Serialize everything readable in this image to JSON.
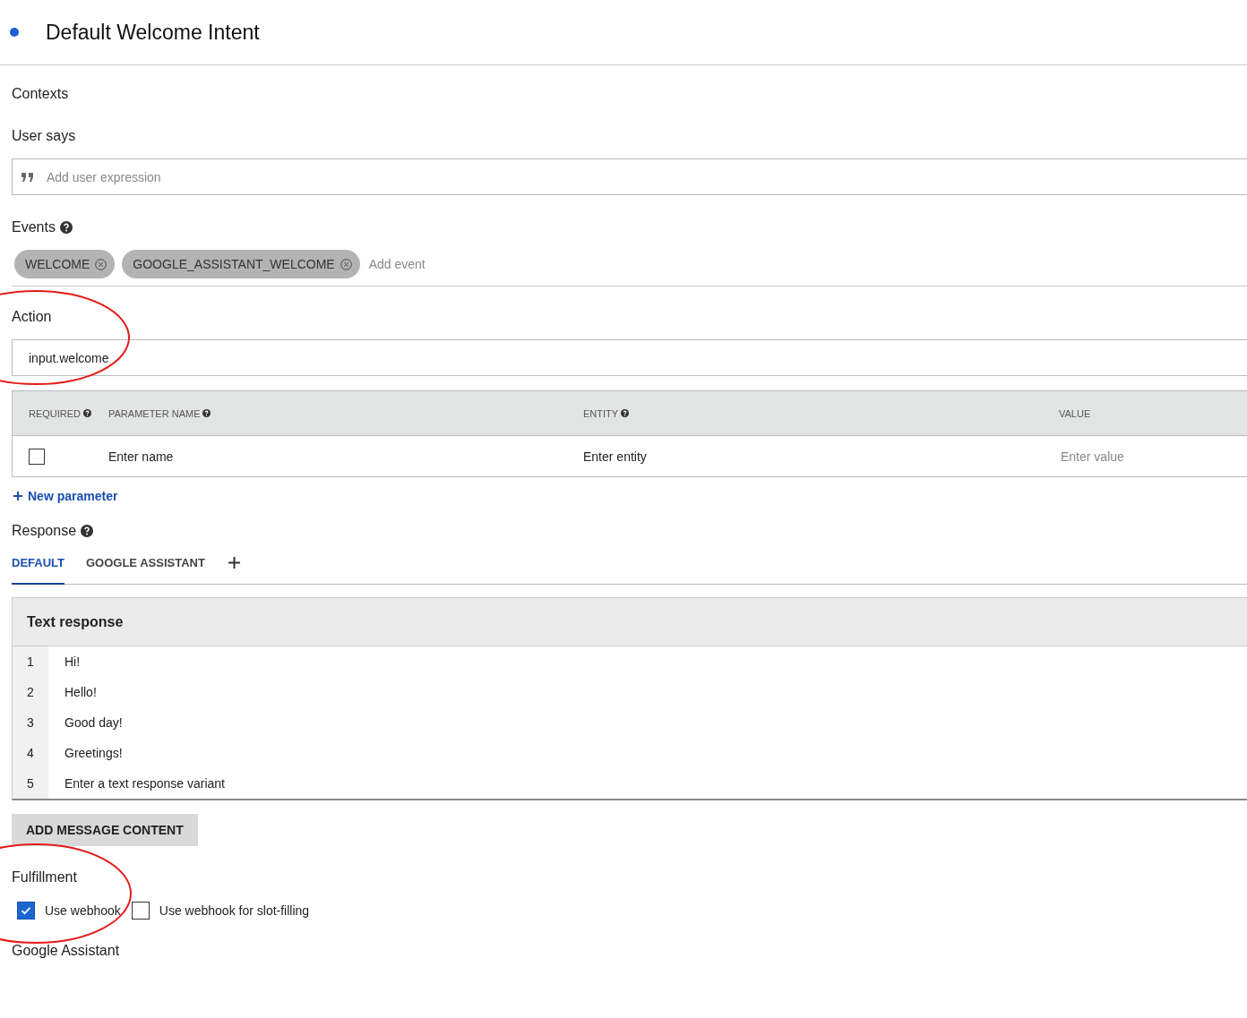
{
  "intent": {
    "title": "Default Welcome Intent"
  },
  "contexts": {
    "label": "Contexts"
  },
  "user_says": {
    "label": "User says",
    "placeholder": "Add user expression"
  },
  "events": {
    "label": "Events",
    "chips": [
      {
        "label": "WELCOME"
      },
      {
        "label": "GOOGLE_ASSISTANT_WELCOME"
      }
    ],
    "placeholder": "Add event"
  },
  "action": {
    "label": "Action",
    "value": "input.welcome",
    "circled": true
  },
  "parameters": {
    "columns": [
      {
        "label": "REQUIRED",
        "help": true
      },
      {
        "label": "PARAMETER NAME",
        "help": true
      },
      {
        "label": "ENTITY",
        "help": true
      },
      {
        "label": "VALUE",
        "help": false
      }
    ],
    "rows": [
      {
        "required": false,
        "name": "Enter name",
        "entity": "Enter entity",
        "value_placeholder": "Enter value"
      }
    ],
    "new_parameter": "New parameter"
  },
  "response": {
    "label": "Response",
    "tabs": [
      {
        "label": "DEFAULT",
        "selected": true
      },
      {
        "label": "GOOGLE ASSISTANT",
        "selected": false
      }
    ],
    "card_title": "Text response",
    "rows": [
      {
        "index": "1",
        "text": "Hi!"
      },
      {
        "index": "2",
        "text": "Hello!"
      },
      {
        "index": "3",
        "text": "Good day!"
      },
      {
        "index": "4",
        "text": "Greetings!"
      },
      {
        "index": "5",
        "text": "Enter a text response variant"
      }
    ],
    "add_button": "ADD MESSAGE CONTENT"
  },
  "fulfillment": {
    "label": "Fulfillment",
    "circled": true,
    "options": [
      {
        "label": "Use webhook",
        "checked": true
      },
      {
        "label": "Use webhook for slot-filling",
        "checked": false
      }
    ]
  },
  "google_assistant": {
    "label": "Google Assistant"
  }
}
